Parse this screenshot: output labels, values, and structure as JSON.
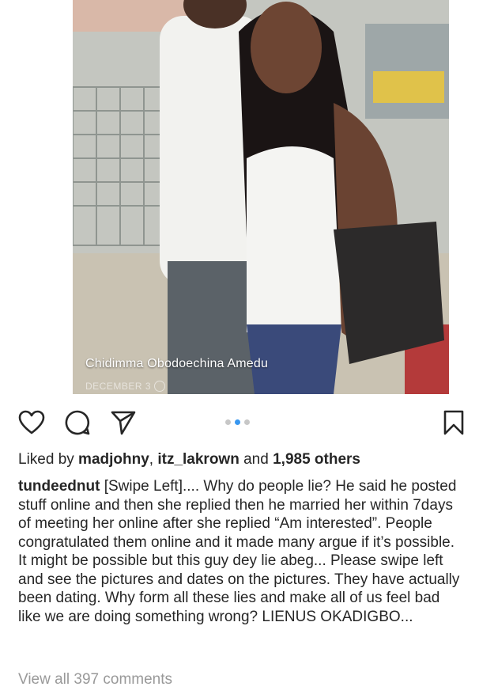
{
  "post": {
    "photo_tag_name": "Chidimma Obodoechina Amedu",
    "photo_tag_date": "DECEMBER 3"
  },
  "actions": {
    "like_icon": "heart-icon",
    "comment_icon": "comment-icon",
    "share_icon": "send-icon",
    "save_icon": "bookmark-icon"
  },
  "carousel": {
    "total": 3,
    "active_index": 1,
    "active_color": "#3897f0"
  },
  "likes": {
    "prefix": "Liked by ",
    "user1": "madjohny",
    "separator": ", ",
    "user2": "itz_lakrown",
    "middle": " and ",
    "count": "1,985 others"
  },
  "caption": {
    "username": "tundeednut",
    "text": " [Swipe Left].... Why do people lie? He said he posted stuff online and then she replied then he married her within 7days of meeting her online after she replied “Am interested”. People congratulated them online and it made many argue if it’s possible. It might be possible but this guy dey lie abeg... Please swipe left and see the pictures and dates on the pictures. They have actually been dating. Why form all these lies and make all of us feel bad like we are doing something wrong? LIENUS OKADIGBO..."
  },
  "comments": {
    "view_all": "View all 397 comments"
  }
}
